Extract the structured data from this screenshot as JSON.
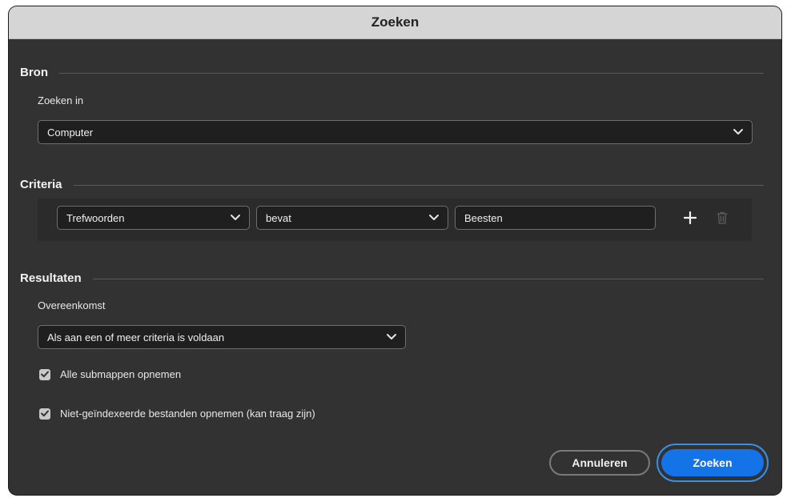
{
  "window": {
    "title": "Zoeken"
  },
  "source": {
    "heading": "Bron",
    "search_in_label": "Zoeken in",
    "search_in_value": "Computer"
  },
  "criteria": {
    "heading": "Criteria",
    "rows": [
      {
        "field": "Trefwoorden",
        "operator": "bevat",
        "value": "Beesten"
      }
    ]
  },
  "results": {
    "heading": "Resultaten",
    "match_label": "Overeenkomst",
    "match_value": "Als aan een of meer criteria is voldaan",
    "options": [
      {
        "label": "Alle submappen opnemen",
        "checked": true
      },
      {
        "label": "Niet-geïndexeerde bestanden opnemen (kan traag zijn)",
        "checked": true
      }
    ]
  },
  "buttons": {
    "cancel": "Annuleren",
    "search": "Zoeken"
  },
  "colors": {
    "dialog_bg": "#323232",
    "accent": "#1473e6"
  }
}
